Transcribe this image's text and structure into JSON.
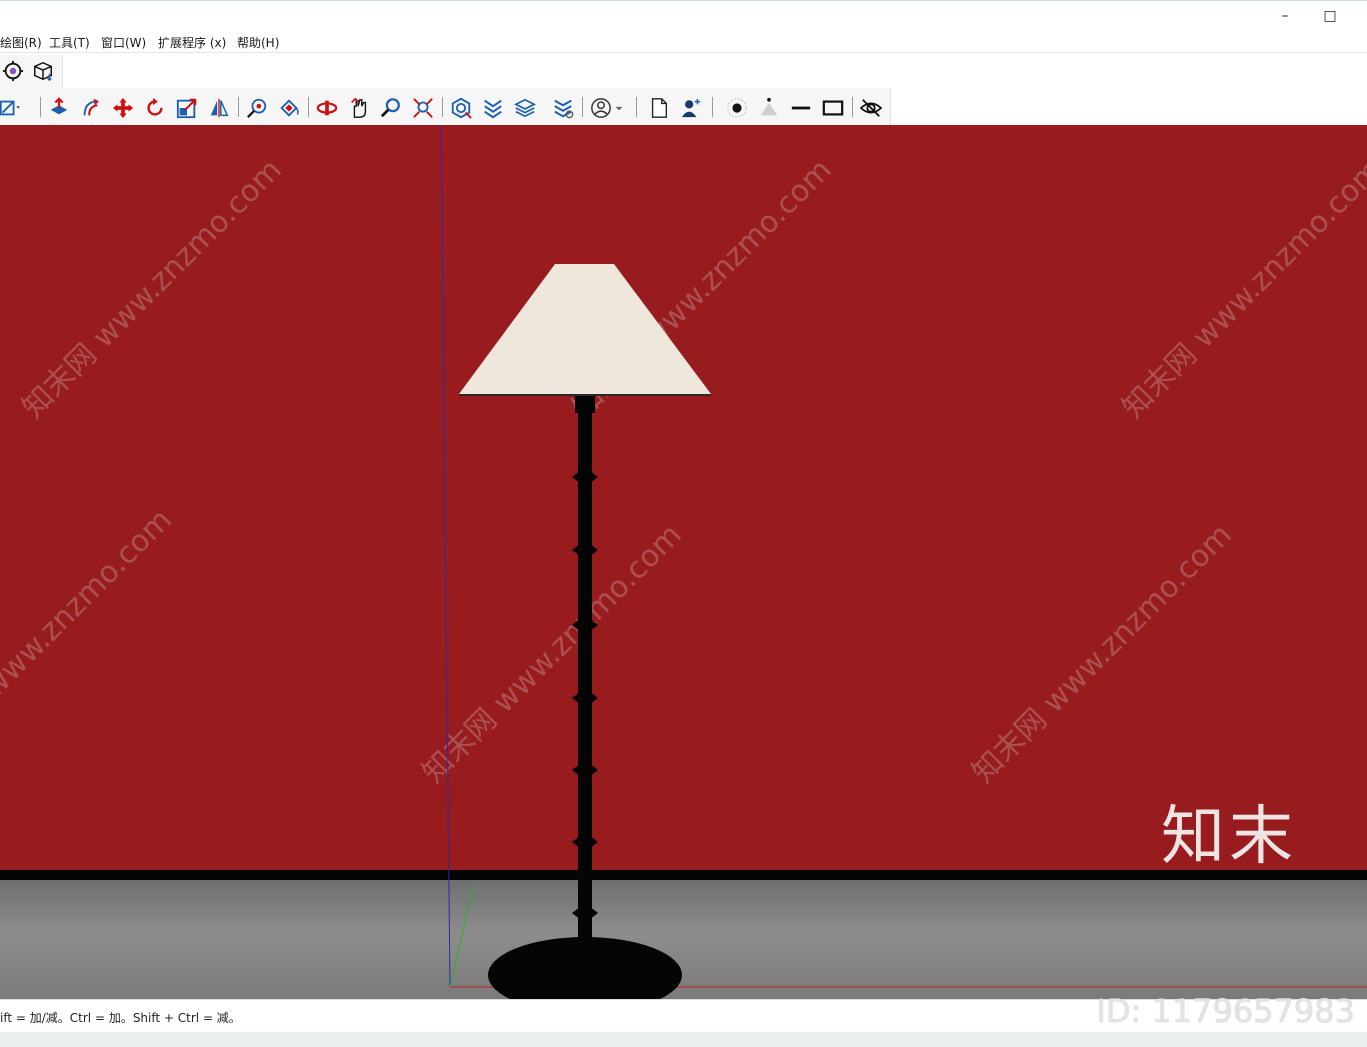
{
  "window": {
    "minimize_glyph": "–",
    "maximize_glyph": "□"
  },
  "menu": {
    "items": [
      {
        "label": "绘图(R)"
      },
      {
        "label": "工具(T)"
      },
      {
        "label": "窗口(W)"
      },
      {
        "label": "扩展程序 (x)"
      },
      {
        "label": "帮助(H)"
      }
    ]
  },
  "toolbar_top": {
    "icons": [
      "settings-gear-icon",
      "package-box-icon"
    ]
  },
  "toolbar_main": {
    "icons": [
      "select-dropdown-icon",
      "push-pull-icon",
      "follow-me-icon",
      "move-icon",
      "rotate-icon",
      "scale-icon",
      "mirror-icon",
      "tape-measure-icon",
      "paint-bucket-icon",
      "orbit-icon",
      "pan-icon",
      "zoom-icon",
      "zoom-extents-icon",
      "component-icon",
      "section-icon",
      "layers-icon",
      "tags-icon",
      "account-icon",
      "new-page-icon",
      "add-user-icon",
      "point-icon",
      "cone-icon",
      "line-icon",
      "rectangle-icon",
      "hide-icon"
    ]
  },
  "viewport": {
    "wall_color": "#981b1e",
    "floor_color": "#7e7e7e",
    "lampshade_color": "#efe6dc",
    "lamp_body_color": "#050505",
    "watermark_text": "知末网 www.znzmo.com",
    "brand_logo": "知末",
    "id_label": "ID: 1179657983"
  },
  "statusbar": {
    "hint": "ift = 加/减。Ctrl = 加。Shift + Ctrl = 减。"
  }
}
